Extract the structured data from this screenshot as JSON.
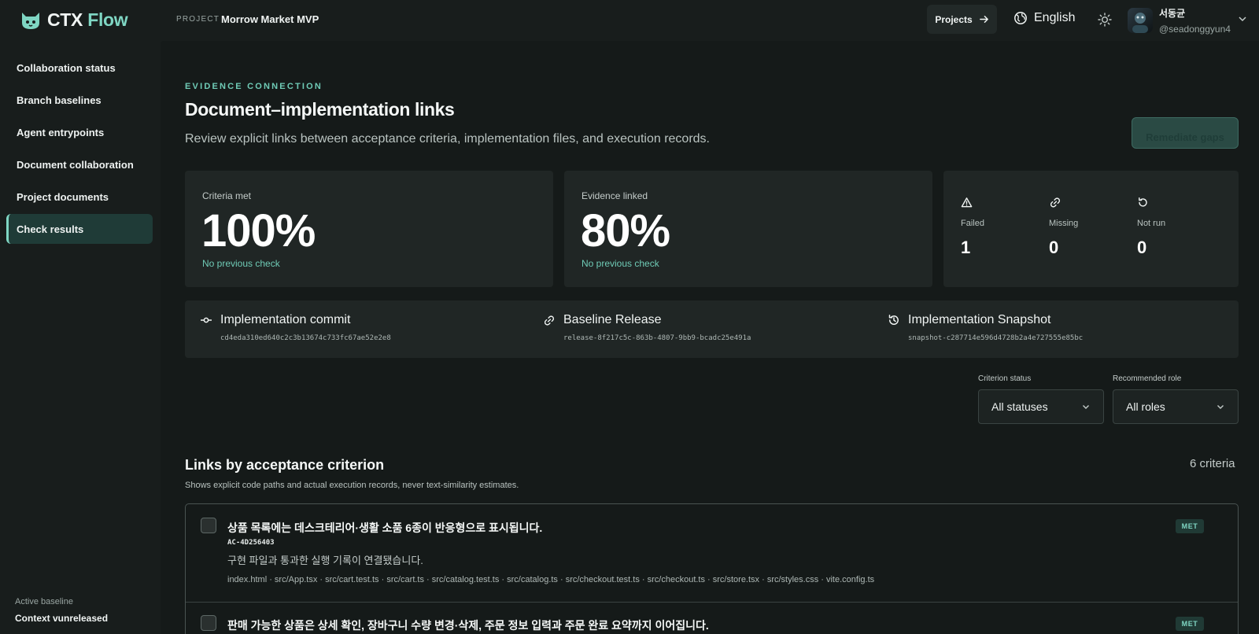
{
  "app": {
    "logo_word1": "CTX",
    "logo_word2": "Flow",
    "project_label": "PROJECT",
    "project_name": "Morrow Market MVP"
  },
  "header": {
    "projects_label": "Projects",
    "language": "English",
    "user_name": "서동균",
    "user_handle": "@seadonggyun4"
  },
  "sidebar": {
    "items": [
      {
        "label": "Collaboration status"
      },
      {
        "label": "Branch baselines"
      },
      {
        "label": "Agent entrypoints"
      },
      {
        "label": "Document collaboration"
      },
      {
        "label": "Project documents"
      },
      {
        "label": "Check results",
        "active": true
      }
    ],
    "baseline_label": "Active baseline",
    "baseline_value": "Context vunreleased"
  },
  "page": {
    "eyebrow": "EVIDENCE CONNECTION",
    "title": "Document–implementation links",
    "subtitle": "Review explicit links between acceptance criteria, implementation files, and execution records.",
    "remediate_label": "Remediate gaps"
  },
  "stats": {
    "criteria": {
      "label": "Criteria met",
      "value": "100%",
      "note": "No previous check"
    },
    "evidence": {
      "label": "Evidence linked",
      "value": "80%",
      "note": "No previous check"
    },
    "failed": {
      "label": "Failed",
      "value": "1"
    },
    "missing": {
      "label": "Missing",
      "value": "0"
    },
    "not_run": {
      "label": "Not run",
      "value": "0"
    }
  },
  "refs": {
    "commit": {
      "label": "Implementation commit",
      "value": "cd4eda310ed640c2c3b13674c733fc67ae52e2e8"
    },
    "release": {
      "label": "Baseline Release",
      "value": "release-8f217c5c-863b-4807-9bb9-bcadc25e491a"
    },
    "snapshot": {
      "label": "Implementation Snapshot",
      "value": "snapshot-c287714e596d4728b2a4e727555e85bc"
    }
  },
  "filters": {
    "status_label": "Criterion status",
    "status_value": "All statuses",
    "role_label": "Recommended role",
    "role_value": "All roles"
  },
  "section": {
    "title": "Links by acceptance criterion",
    "count": "6 criteria",
    "description": "Shows explicit code paths and actual execution records, never text-similarity estimates."
  },
  "criteria": [
    {
      "title": "상품 목록에는 데스크테리어·생활 소품 6종이 반응형으로 표시됩니다.",
      "id": "AC-4D256403",
      "description": "구현 파일과 통과한 실행 기록이 연결됐습니다.",
      "files": "index.html · src/App.tsx · src/cart.test.ts · src/cart.ts · src/catalog.test.ts · src/catalog.ts · src/checkout.test.ts · src/checkout.ts · src/store.tsx · src/styles.css · vite.config.ts",
      "badge": "MET"
    },
    {
      "title": "판매 가능한 상품은 상세 확인, 장바구니 수량 변경·삭제, 주문 정보 입력과 주문 완료 요약까지 이어집니다.",
      "badge": "MET"
    }
  ]
}
